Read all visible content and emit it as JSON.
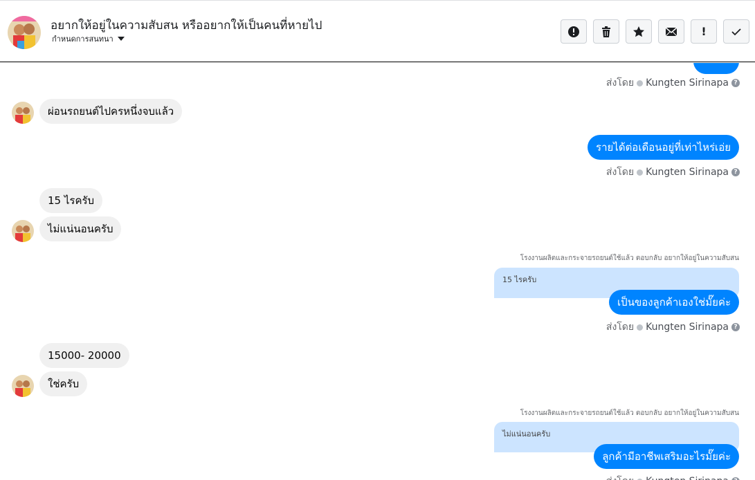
{
  "header": {
    "title": "อยากให้อยู่ในความสับสน หรืออยากให้เป็นคนที่หายไป",
    "subtitle": "กำหนดการสนทนา",
    "actions": [
      "report",
      "delete",
      "star",
      "mail",
      "alert",
      "done"
    ],
    "alert_label": "!"
  },
  "messages": {
    "sent_by_label": "ส่งโดย",
    "agent_name": "Kungten Sirinapa",
    "in_1": "ผ่อนรถยนต์ไปครหนึ่งจบแล้ว",
    "out_1": "รายได้ต่อเดือนอยู่ที่เท่าไหร่เอ่ย",
    "in_2a": "15 ไรครับ",
    "in_2b": "ไม่แน่นอนครับ",
    "reply_note_1": "โรงงานผลิตและกระจายรถยนต์ใช้แล้ว ตอบกลับ อยากให้อยู่ในความสับสน",
    "quote_1": "15 ไรครับ",
    "out_2": "เป็นของลูกค้าเองใช่มั๊ยค่ะ",
    "in_3a": "15000- 20000",
    "in_3b": "ใช่ครับ",
    "reply_note_2": "โรงงานผลิตและกระจายรถยนต์ใช้แล้ว ตอบกลับ อยากให้อยู่ในความสับสน",
    "quote_2": "ไม่แน่นอนครับ",
    "out_3": "ลูกค้ามีอาชีพเสริมอะไรมั๊ยค่ะ"
  },
  "colors": {
    "outgoing": "#0084ff",
    "incoming": "#f0f0f0",
    "quote": "#cce4ff"
  }
}
